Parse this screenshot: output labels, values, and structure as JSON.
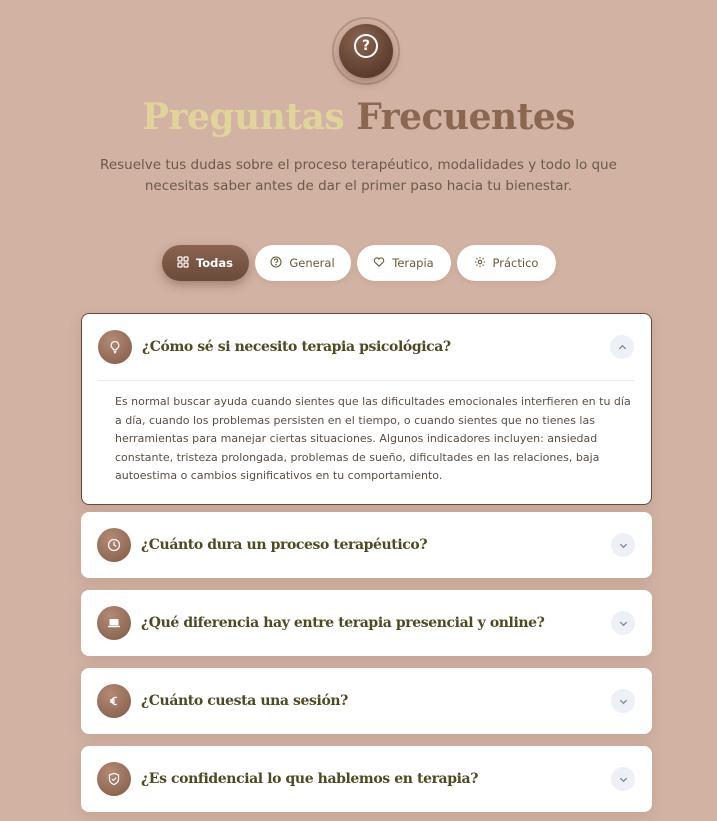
{
  "hero": {
    "icon": "question-icon",
    "badge_glyph": "?",
    "title_part1": "Preguntas",
    "title_part2": "Frecuentes",
    "subtitle": "Resuelve tus dudas sobre el proceso terapéutico, modalidades y todo lo que necesitas saber antes de dar el primer paso hacia tu bienestar."
  },
  "filters": [
    {
      "label": "Todas",
      "icon": "grid-icon",
      "active": true
    },
    {
      "label": "General",
      "icon": "help-circle-icon",
      "active": false
    },
    {
      "label": "Terapia",
      "icon": "heart-icon",
      "active": false
    },
    {
      "label": "Práctico",
      "icon": "gear-icon",
      "active": false
    }
  ],
  "faqs": [
    {
      "icon": "lightbulb-icon",
      "question": "¿Cómo sé si necesito terapia psicológica?",
      "expanded": true,
      "answer": "Es normal buscar ayuda cuando sientes que las dificultades emocionales interfieren en tu día a día, cuando los problemas persisten en el tiempo, o cuando sientes que no tienes las herramientas para manejar ciertas situaciones. Algunos indicadores incluyen: ansiedad constante, tristeza prolongada, problemas de sueño, dificultades en las relaciones, baja autoestima o cambios significativos en tu comportamiento."
    },
    {
      "icon": "clock-icon",
      "question": "¿Cuánto dura un proceso terapéutico?",
      "expanded": false
    },
    {
      "icon": "laptop-icon",
      "question": "¿Qué diferencia hay entre terapia presencial y online?",
      "expanded": false
    },
    {
      "icon": "euro-icon",
      "question": "¿Cuánto cuesta una sesión?",
      "expanded": false
    },
    {
      "icon": "shield-icon",
      "question": "¿Es confidencial lo que hablemos en terapia?",
      "expanded": false
    }
  ],
  "colors": {
    "background": "#d2b2a3",
    "accent": "#8a6450",
    "title_light": "#e0d49a",
    "question_text": "#4e4a22"
  }
}
